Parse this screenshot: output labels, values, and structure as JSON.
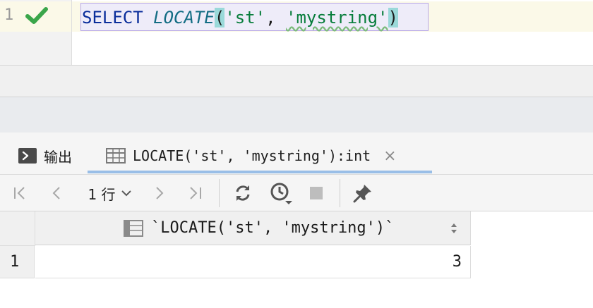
{
  "editor": {
    "line_number": "1",
    "status_icon": "check-icon",
    "query": {
      "keyword": "SELECT",
      "function": "LOCATE",
      "open_paren": "(",
      "arg1": "'st'",
      "comma": ", ",
      "arg2": "'mystring'",
      "close_paren": ")"
    }
  },
  "tabs": {
    "output_label": "输出",
    "result_label": "LOCATE('st', 'mystring'):int",
    "close_glyph": "×"
  },
  "toolbar": {
    "first_glyph": "|<",
    "prev_glyph": "<",
    "page_label": "1 行",
    "next_glyph": ">",
    "last_glyph": ">|"
  },
  "grid": {
    "column_header": "`LOCATE('st', 'mystring')`",
    "rows": [
      {
        "row_number": "1",
        "value": "3"
      }
    ]
  },
  "colors": {
    "keyword": "#0a2e9b",
    "function": "#136d84",
    "string": "#077d3b",
    "success": "#3aa64a",
    "accent": "#4d8fdb"
  }
}
